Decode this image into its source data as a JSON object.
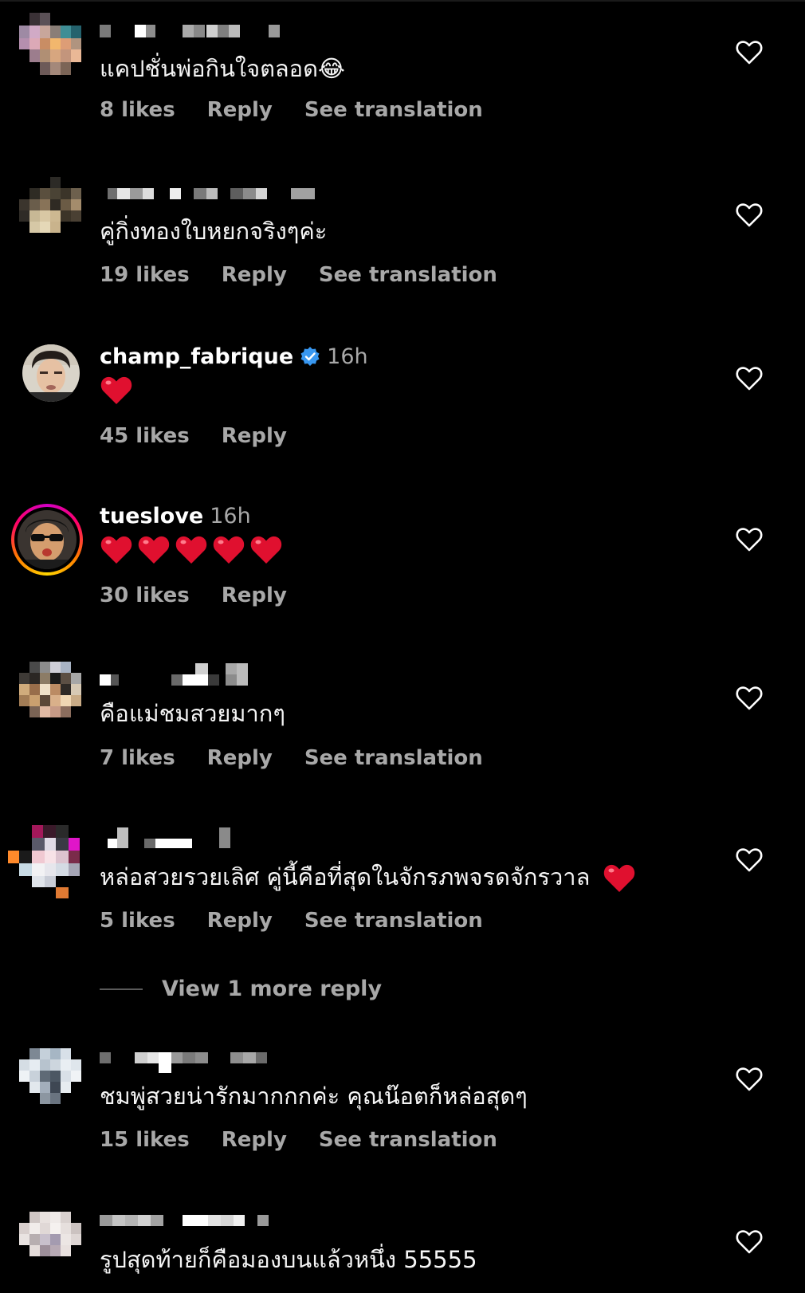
{
  "comments": [
    {
      "text": "แคปชั่นพ่อกินใจตลอด",
      "emoji": "😂",
      "likes": "8 likes",
      "reply": "Reply",
      "translate": "See translation"
    },
    {
      "text": "คู่กิ่งทองใบหยกจริงๆค่ะ",
      "likes": "19 likes",
      "reply": "Reply",
      "translate": "See translation"
    },
    {
      "username": "champ_fabrique",
      "time": "16h",
      "likes": "45 likes",
      "reply": "Reply",
      "hearts": 1
    },
    {
      "username": "tueslove",
      "time": "16h",
      "likes": "30 likes",
      "reply": "Reply",
      "hearts": 5
    },
    {
      "text": "คือแม่ชมสวยมากๆ",
      "likes": "7 likes",
      "reply": "Reply",
      "translate": "See translation"
    },
    {
      "text": "หล่อสวยรวยเลิศ คู่นี้คือที่สุดในจักรภพจรดจักรวาล",
      "likes": "5 likes",
      "reply": "Reply",
      "translate": "See translation",
      "view_more": "View 1 more reply"
    },
    {
      "text": "ชมพู่สวยน่ารักมากกกค่ะ คุณน๊อตก็หล่อสุดๆ",
      "likes": "15 likes",
      "reply": "Reply",
      "translate": "See translation"
    },
    {
      "text": "รูปสุดท้ายก็คือมองบนแล้วหนึ่ง 55555"
    }
  ],
  "icons": {
    "like": "heart-outline-icon",
    "verified": "verified-badge-icon",
    "heart_emoji": "red-heart-emoji"
  },
  "colors": {
    "background": "#000000",
    "primary_text": "#ffffff",
    "secondary_text": "#a8a8a8",
    "verified": "#3897f0",
    "heart": "#e0102f"
  }
}
